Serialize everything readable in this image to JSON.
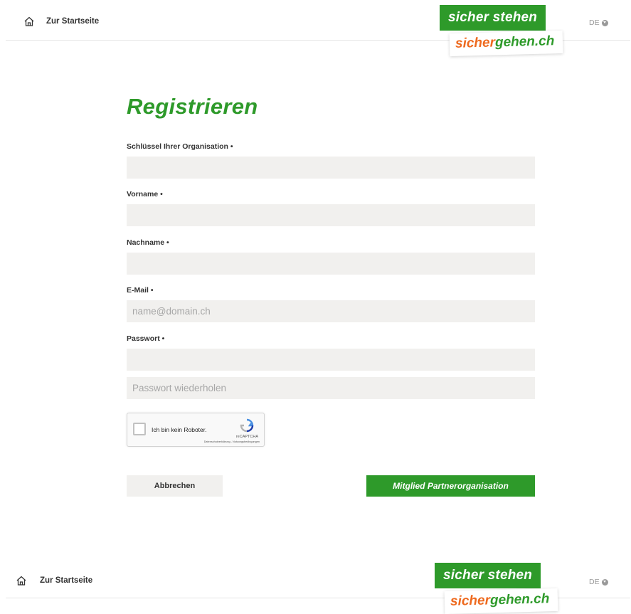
{
  "header": {
    "home_label": "Zur Startseite",
    "logo_top": "sicher stehen",
    "logo_bottom_orange": "sicher",
    "logo_bottom_green": "gehen.ch",
    "language": "DE"
  },
  "form": {
    "title": "Registrieren",
    "fields": [
      {
        "label": "Schlüssel Ihrer Organisation •",
        "value": "",
        "placeholder": ""
      },
      {
        "label": "Vorname •",
        "value": "",
        "placeholder": ""
      },
      {
        "label": "Nachname •",
        "value": "",
        "placeholder": ""
      },
      {
        "label": "E-Mail •",
        "value": "",
        "placeholder": "name@domain.ch"
      },
      {
        "label": "Passwort •",
        "value": "",
        "placeholder": ""
      }
    ],
    "password_repeat_placeholder": "Passwort wiederholen",
    "captcha": {
      "label": "Ich bin kein Roboter.",
      "brand": "reCAPTCHA",
      "terms": "Datenschutzerklärung - Nutzungsbedingungen"
    },
    "cancel_label": "Abbrechen",
    "submit_label": "Mitglied Partnerorganisation"
  },
  "colors": {
    "brand_green": "#2e9a2a",
    "brand_orange": "#ee6a1f",
    "input_bg": "#f1f0ee"
  }
}
